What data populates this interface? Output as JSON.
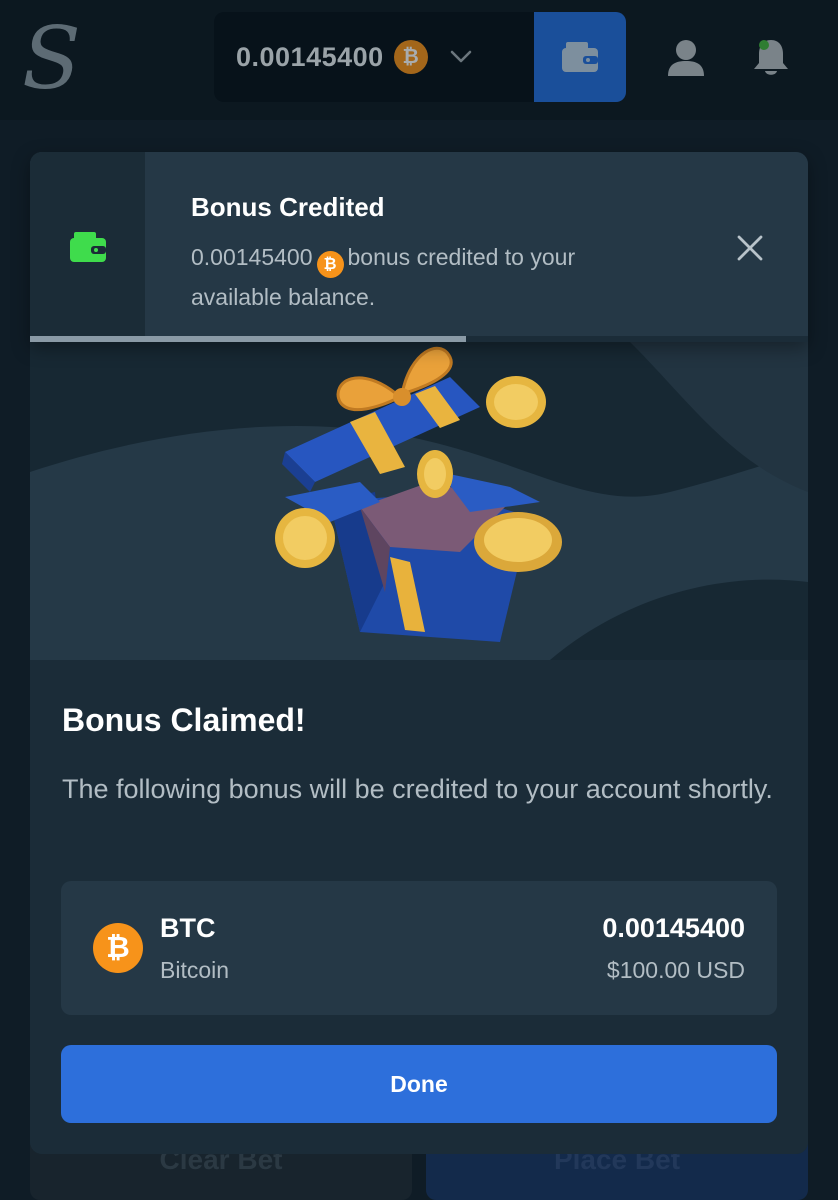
{
  "header": {
    "logo_text": "S",
    "balance": "0.00145400",
    "currency_icon": "bitcoin-icon",
    "dropdown_icon": "chevron-down-icon",
    "wallet_icon": "wallet-icon",
    "user_icon": "user-icon",
    "notifications_icon": "bell-icon"
  },
  "background": {
    "clear_bet_label": "Clear Bet",
    "place_bet_label": "Place Bet"
  },
  "toast": {
    "icon": "wallet-icon",
    "title": "Bonus Credited",
    "amount": "0.00145400",
    "message_after_amount": "bonus credited to your available balance.",
    "close_icon": "close-icon",
    "progress_fraction": 0.56
  },
  "modal": {
    "hero_image": "gift-box-with-coins",
    "title": "Bonus Claimed!",
    "description": "The following bonus will be credited to your account shortly.",
    "reward": {
      "code": "BTC",
      "name": "Bitcoin",
      "amount": "0.00145400",
      "usd_value": "$100.00 USD"
    },
    "done_label": "Done"
  },
  "colors": {
    "accent_blue": "#2d6fdb",
    "bitcoin_orange": "#f7931a",
    "wallet_green": "#3fdc4c",
    "modal_bg": "#1b2c38"
  }
}
